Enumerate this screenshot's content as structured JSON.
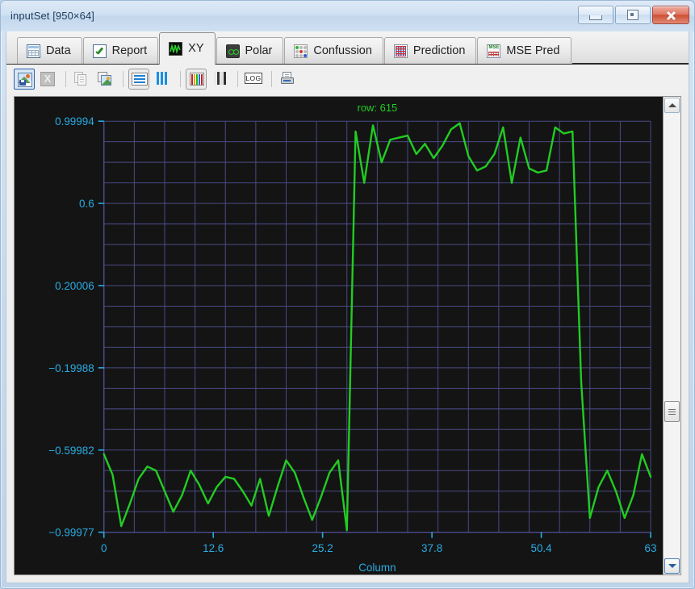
{
  "window": {
    "title": "inputSet [950×64]",
    "controls": [
      {
        "name": "minimize",
        "label": "Minimize"
      },
      {
        "name": "maximize",
        "label": "Maximize"
      },
      {
        "name": "close",
        "label": "Close"
      }
    ]
  },
  "tabs": [
    {
      "label": "Data",
      "icon": "table-icon",
      "active": false
    },
    {
      "label": "Report",
      "icon": "checkmark-icon",
      "active": false
    },
    {
      "label": "XY",
      "icon": "waveform-icon",
      "active": true
    },
    {
      "label": "Polar",
      "icon": "polar-icon",
      "active": false
    },
    {
      "label": "Confussion",
      "icon": "dots-matrix-icon",
      "active": false
    },
    {
      "label": "Prediction",
      "icon": "grid-chart-icon",
      "active": false
    },
    {
      "label": "MSE Pred",
      "icon": "mse-grid-icon",
      "active": false
    }
  ],
  "toolbar": {
    "buttons": [
      {
        "name": "save-image-button",
        "icon": "save-image-icon",
        "tooltip": "Save image",
        "enabled": true,
        "selected": true
      },
      {
        "name": "export-excel-button",
        "icon": "excel-icon",
        "tooltip": "Export to Excel",
        "enabled": false,
        "selected": false
      },
      {
        "name": "copy-button",
        "icon": "copy-pages-icon",
        "tooltip": "Copy",
        "enabled": false,
        "selected": false
      },
      {
        "name": "copy-image-button",
        "icon": "copy-image-icon",
        "tooltip": "Copy image",
        "enabled": true,
        "selected": false
      },
      {
        "name": "horizontal-bars-button",
        "icon": "horizontal-bars-icon",
        "tooltip": "Horizontal bars",
        "enabled": true,
        "selected": true
      },
      {
        "name": "vertical-bars-button",
        "icon": "vertical-bars-icon",
        "tooltip": "Vertical bars",
        "enabled": true,
        "selected": false
      },
      {
        "name": "color-scale-button",
        "icon": "color-bars-icon",
        "tooltip": "Color scale",
        "enabled": true,
        "selected": true
      },
      {
        "name": "gray-scale-button",
        "icon": "gray-bars-icon",
        "tooltip": "Gray scale",
        "enabled": true,
        "selected": false
      },
      {
        "name": "log-scale-button",
        "icon": "log-icon",
        "tooltip": "Log scale",
        "enabled": true,
        "selected": false,
        "text": "LOG"
      },
      {
        "name": "print-button",
        "icon": "printer-icon",
        "tooltip": "Print",
        "enabled": true,
        "selected": false
      }
    ],
    "log_label": "LOG"
  },
  "scrollbar": {
    "up_label": "▲",
    "down_label": "▼",
    "thumb_position_pct": 68
  },
  "chart_data": {
    "type": "line",
    "title": "row: 615",
    "xlabel": "Column",
    "ylabel": "",
    "xlim": [
      0,
      63
    ],
    "ylim": [
      -0.99977,
      0.99994
    ],
    "xticks": [
      0,
      12.6,
      25.2,
      37.8,
      50.4,
      63
    ],
    "xticklabels": [
      "0",
      "12.6",
      "25.2",
      "37.8",
      "50.4",
      "63"
    ],
    "yticks": [
      0.99994,
      0.6,
      0.20006,
      -0.19988,
      -0.59982,
      -0.99977
    ],
    "yticklabels": [
      "0.99994",
      "0.6",
      "0.20006",
      "-0.19988",
      "-0.59982",
      "-0.99977"
    ],
    "grid": true,
    "grid_color": "#4d4d8c",
    "background": "#141414",
    "line_color": "#22cc22",
    "axis_color": "#29abe2",
    "title_color": "#22cc22",
    "legend": null,
    "series": [
      {
        "name": "row 615",
        "x": [
          0,
          1,
          2,
          3,
          4,
          5,
          6,
          7,
          8,
          9,
          10,
          11,
          12,
          13,
          14,
          15,
          16,
          17,
          18,
          19,
          20,
          21,
          22,
          23,
          24,
          25,
          26,
          27,
          28,
          29,
          30,
          31,
          32,
          33,
          34,
          35,
          36,
          37,
          38,
          39,
          40,
          41,
          42,
          43,
          44,
          45,
          46,
          47,
          48,
          49,
          50,
          51,
          52,
          53,
          54,
          55,
          56,
          57,
          58,
          59,
          60,
          61,
          62,
          63
        ],
        "values": [
          -0.62,
          -0.72,
          -0.97,
          -0.86,
          -0.74,
          -0.68,
          -0.7,
          -0.8,
          -0.9,
          -0.82,
          -0.7,
          -0.77,
          -0.86,
          -0.78,
          -0.73,
          -0.74,
          -0.8,
          -0.87,
          -0.74,
          -0.92,
          -0.78,
          -0.65,
          -0.71,
          -0.83,
          -0.94,
          -0.83,
          -0.71,
          -0.65,
          -0.99,
          0.95,
          0.7,
          0.98,
          0.8,
          0.91,
          0.92,
          0.93,
          0.84,
          0.89,
          0.82,
          0.88,
          0.96,
          0.99,
          0.83,
          0.76,
          0.78,
          0.84,
          0.97,
          0.7,
          0.92,
          0.77,
          0.75,
          0.76,
          0.97,
          0.94,
          0.95,
          -0.27,
          -0.93,
          -0.78,
          -0.7,
          -0.8,
          -0.93,
          -0.82,
          -0.62,
          -0.73
        ]
      }
    ]
  }
}
